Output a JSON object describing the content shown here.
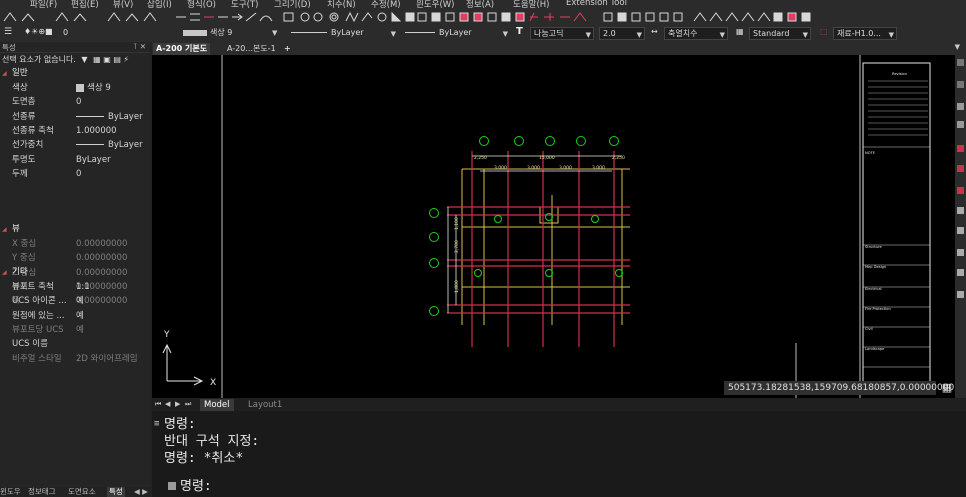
{
  "menu": [
    "파일(F)",
    "편집(E)",
    "뷰(V)",
    "삽입(I)",
    "형식(O)",
    "도구(T)",
    "그리기(D)",
    "치수(N)",
    "수정(M)",
    "윈도우(W)",
    "정보(A)",
    "도움말(H)",
    "Extension Tool"
  ],
  "toolbar2": {
    "layer": "0",
    "color": "색상 9",
    "linetype": "ByLayer",
    "lineweight": "ByLayer",
    "text_font": "나눔고딕",
    "text_height": "2.0",
    "dim_style": "축열치수",
    "table_style": "Standard",
    "block": "재료-H1.0..."
  },
  "properties": {
    "title": "특성",
    "selection": "선택 요소가 없습니다.",
    "categories": {
      "general": "일반",
      "view": "뷰",
      "misc": "기타"
    },
    "general": [
      {
        "key": "색상",
        "value": "색상 9"
      },
      {
        "key": "도면층",
        "value": "0"
      },
      {
        "key": "선종류",
        "value": "ByLayer"
      },
      {
        "key": "선종류 축척",
        "value": "1.000000"
      },
      {
        "key": "선가중치",
        "value": "ByLayer"
      },
      {
        "key": "투명도",
        "value": "ByLayer"
      },
      {
        "key": "두께",
        "value": "0"
      }
    ],
    "view": [
      {
        "key": "X 중심",
        "value": "0.00000000"
      },
      {
        "key": "Y 중심",
        "value": "0.00000000"
      },
      {
        "key": "Z 중심",
        "value": "0.00000000"
      },
      {
        "key": "높이",
        "value": "0.00000000"
      },
      {
        "key": "폭",
        "value": "0.00000000"
      }
    ],
    "misc": [
      {
        "key": "뷰포트 축척",
        "value": "1:1"
      },
      {
        "key": "UCS 아이콘 ...",
        "value": "예"
      },
      {
        "key": "원점에 있는 ...",
        "value": "예"
      },
      {
        "key": "뷰포트당 UCS",
        "value": "예"
      },
      {
        "key": "UCS 이름",
        "value": ""
      },
      {
        "key": "비주얼 스타일",
        "value": "2D 와이어프레임"
      }
    ]
  },
  "doc_tabs": [
    "A-200 기본도",
    "A-20...본도-1"
  ],
  "add_tab": "+",
  "ucs": {
    "y": "Y",
    "x": "X"
  },
  "coords": "505173.18281538,159709.68180857,0.00000000",
  "layout_tabs": [
    "Model",
    "Layout1"
  ],
  "command_history": [
    "명령:",
    "반대 구석 지정:",
    "명령: *취소*"
  ],
  "command_prompt": "명령:",
  "bottom_tabs": [
    "윈도우",
    "정보태그",
    "도면요소",
    "특성"
  ],
  "drawing": {
    "dim_total": "15,000",
    "dim_left": "2,250",
    "dim_right": "2,250",
    "dims_inner": [
      "3,000",
      "3,000",
      "3,000",
      "3,000"
    ],
    "dims_vertical": [
      "1,100",
      "2,700",
      "1,800"
    ],
    "title_block": [
      "Revision",
      "NOTE",
      "Structure",
      "Mep Design",
      "Electrical",
      "Fire Protection",
      "Civil",
      "Landscape"
    ]
  },
  "colors": {
    "grid_red": "#d0304a",
    "grid_yellow": "#d8c050",
    "bubble": "#18d418"
  }
}
